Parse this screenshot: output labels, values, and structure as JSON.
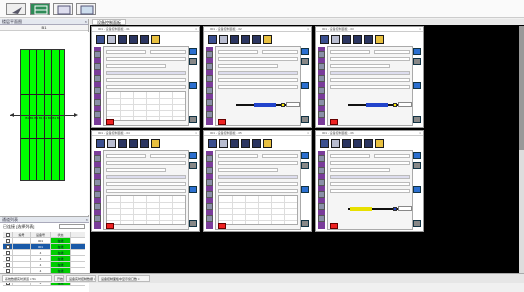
{
  "toolbar": {
    "buttons": [
      {
        "icon": "pointer-icon"
      },
      {
        "icon": "grid-view-icon",
        "active": true
      },
      {
        "icon": "list-view-icon"
      },
      {
        "icon": "window-icon"
      }
    ]
  },
  "left_panel": {
    "floor_header": "楼层平面图",
    "floor_tab": "B1",
    "floor_label": "B1 B1 B1 B1 B1 B1 B1 B1",
    "columns": 6,
    "rows": 3
  },
  "device_list": {
    "header": "通道列表",
    "filter_label": "已连接  [选择列表]",
    "table_headers": [
      "",
      "编号",
      "设备号",
      "状态"
    ],
    "rows": [
      {
        "id": "",
        "device": "001",
        "status": "在线",
        "selected": false
      },
      {
        "id": "",
        "device": "001",
        "status": "在线",
        "selected": true
      },
      {
        "id": "",
        "device": "4",
        "status": "在线",
        "selected": false
      },
      {
        "id": "",
        "device": "4",
        "status": "在线",
        "selected": false
      },
      {
        "id": "",
        "device": "4",
        "status": "在线",
        "selected": false
      },
      {
        "id": "",
        "device": "4",
        "status": "在线",
        "selected": false
      },
      {
        "id": "",
        "device": "4",
        "status": "在线",
        "selected": false
      },
      {
        "id": "",
        "device": "4",
        "status": "在线",
        "selected": false
      }
    ]
  },
  "main": {
    "tab_label": "设备控制面板",
    "windows": [
      {
        "title": "001 - 设备控制面板 - 01",
        "variant": "table"
      },
      {
        "title": "001 - 设备控制面板 - 02",
        "variant": "bar"
      },
      {
        "title": "001 - 设备控制面板 - 03",
        "variant": "bar"
      },
      {
        "title": "001 - 设备控制面板 - 04",
        "variant": "table"
      },
      {
        "title": "001 - 设备控制面板 - 05",
        "variant": "table"
      },
      {
        "title": "001 - 设备控制面板 - 06",
        "variant": "bar-yellow"
      }
    ],
    "close_glyph": "×"
  },
  "bottom_tabs": [
    "系统数据实时通道 × 51",
    "开始",
    "设备实时控制数据 ×",
    "设备控制面板中显示窗口数 ×"
  ],
  "colors": {
    "floor_green": "#00ff00",
    "status_green": "#00cc00",
    "selected_row": "#1a5aa8",
    "side_purple": "#7a3c9a",
    "button_blue": "#2b6fd0"
  }
}
